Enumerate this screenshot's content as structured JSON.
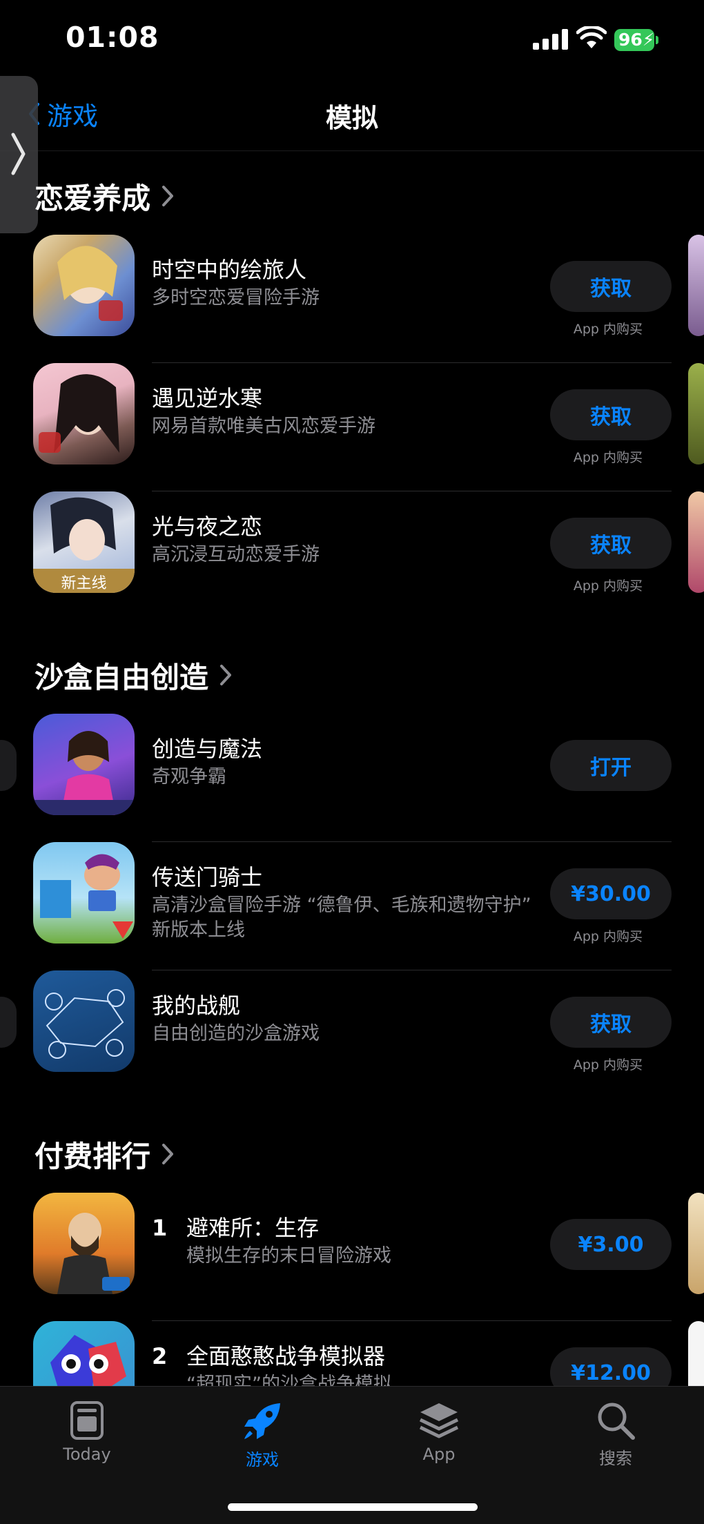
{
  "status": {
    "time": "01:08",
    "battery": "96"
  },
  "nav": {
    "back_label": "游戏",
    "title": "模拟"
  },
  "sections": [
    {
      "title": "恋爱养成",
      "apps": [
        {
          "name": "时空中的绘旅人",
          "subtitle": "多时空恋爱冒险手游",
          "button": "获取",
          "iap": "App 内购买"
        },
        {
          "name": "遇见逆水寒",
          "subtitle": "网易首款唯美古风恋爱手游",
          "button": "获取",
          "iap": "App 内购买"
        },
        {
          "name": "光与夜之恋",
          "subtitle": "高沉浸互动恋爱手游",
          "button": "获取",
          "iap": "App 内购买",
          "icon_badge": "新主线"
        }
      ]
    },
    {
      "title": "沙盒自由创造",
      "apps": [
        {
          "name": "创造与魔法",
          "subtitle": "奇观争霸",
          "button": "打开"
        },
        {
          "name": "传送门骑士",
          "subtitle": "高清沙盒冒险手游 “德鲁伊、毛族和遗物守护” 新版本上线",
          "button": "¥30.00",
          "iap": "App 内购买"
        },
        {
          "name": "我的战舰",
          "subtitle": "自由创造的沙盒游戏",
          "button": "获取",
          "iap": "App 内购买"
        }
      ]
    },
    {
      "title": "付费排行",
      "apps": [
        {
          "rank": "1",
          "name": "避难所：生存",
          "subtitle": "模拟生存的末日冒险游戏",
          "button": "¥3.00"
        },
        {
          "rank": "2",
          "name": "全面憨憨战争模拟器",
          "subtitle": "“超现实”的沙盒战争模拟",
          "button": "¥12.00"
        }
      ]
    }
  ],
  "tabs": [
    {
      "label": "Today",
      "icon": "today-icon",
      "active": false
    },
    {
      "label": "游戏",
      "icon": "rocket-icon",
      "active": true
    },
    {
      "label": "App",
      "icon": "layers-icon",
      "active": false
    },
    {
      "label": "搜索",
      "icon": "search-icon",
      "active": false
    }
  ],
  "colors": {
    "accent": "#0a84ff",
    "background": "#000000",
    "secondary_text": "#8e8e93",
    "battery": "#34c759"
  }
}
